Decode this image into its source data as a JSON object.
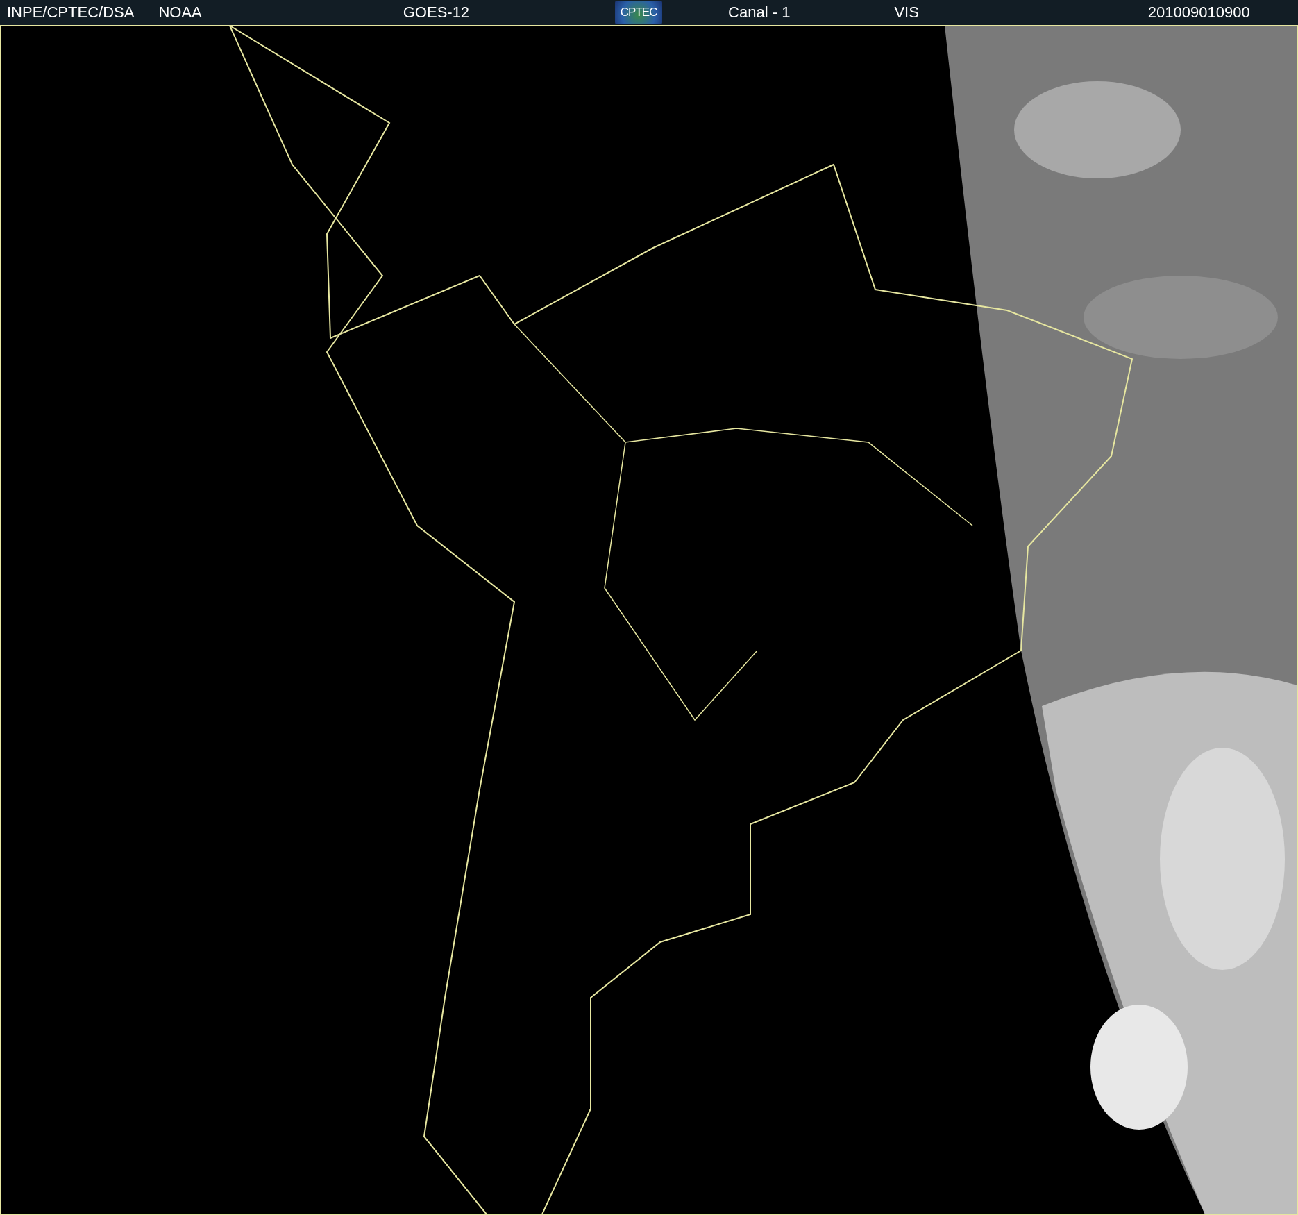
{
  "header": {
    "items": [
      {
        "text": "INPE/CPTEC/DSA"
      },
      {
        "text": "NOAA"
      },
      {
        "text": "GOES-12"
      },
      {
        "kind": "logo",
        "text": "CPTEC"
      },
      {
        "text": "Canal - 1"
      },
      {
        "text": "VIS"
      },
      {
        "text": "201009010900"
      }
    ]
  }
}
